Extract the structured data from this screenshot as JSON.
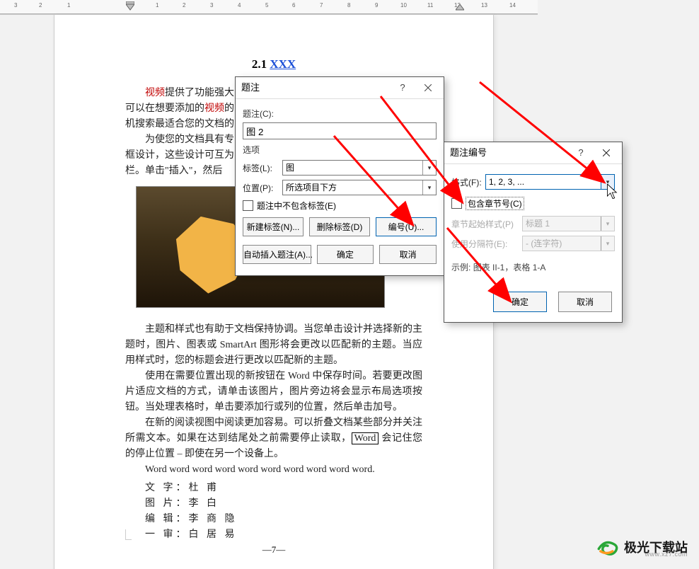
{
  "heading": {
    "num": "2.1",
    "link": "XXX"
  },
  "doc": {
    "para1_a": "视频",
    "para1_b": "提供了功能强大",
    "para1_c": "可以在想要添加的",
    "para1_d": "视频",
    "para1_e": "的",
    "para2": "机搜索最适合您的文档的",
    "para3": "为使您的文档具有专",
    "para4": "框设计，这些设计可互为",
    "para5": "栏。单击\"插入\"，然后",
    "para6": "主题和样式也有助于文档保持协调。当您单击设计并选择新的主题时，图片、图表或 SmartArt 图形将会更改以匹配新的主题。当应用样式时，您的标题会进行更改以匹配新的主题。",
    "para7a": "使用在需要位置出现的新按钮在 Word 中保存时间。若要更改图片适应文档的方式，请单击该图片，图片旁边将会显示布局选项按钮。当处理表格时，单击要添加行或列的位置，然后单击加号。",
    "para8a": "在新的阅读视图中阅读更加容易。可以折叠文档某些部分并关注所需文本。如果在达到结尾处之前需要停止读取，",
    "para8b_box": "Word",
    "para8c": " 会记住您的停止位置 – 即使在另一个设备上。",
    "line_en": "Word word word word word word word word word word.",
    "authors": [
      {
        "label": "文 字：",
        "name": "杜 甫"
      },
      {
        "label": "图 片：",
        "name": "李 白"
      },
      {
        "label": "编 辑：",
        "name": "李 商 隐"
      },
      {
        "label": "一 审：",
        "name": "白 居 易"
      }
    ],
    "page_num": "—7—"
  },
  "dlg1": {
    "title": "题注",
    "lbl_caption": "题注(C):",
    "caption_value": "图 2",
    "lbl_options": "选项",
    "lbl_label": "标签(L):",
    "label_value": "图",
    "lbl_position": "位置(P):",
    "position_value": "所选项目下方",
    "check_exclude": "题注中不包含标签(E)",
    "btn_newlabel": "新建标签(N)...",
    "btn_dellabel": "删除标签(D)",
    "btn_number": "编号(U)...",
    "btn_autoinsert": "自动插入题注(A)...",
    "btn_ok": "确定",
    "btn_cancel": "取消"
  },
  "dlg2": {
    "title": "题注编号",
    "lbl_format": "格式(F):",
    "format_value": "1, 2, 3, ...",
    "check_chapter": "包含章节号(C)",
    "lbl_chapstyle": "章节起始样式(P)",
    "chapstyle_value": "标题 1",
    "lbl_separator": "使用分隔符(E):",
    "separator_value": "- (连字符)",
    "lbl_example": "示例:",
    "example_value": "图表 II-1，表格 1-A",
    "btn_ok": "确定",
    "btn_cancel": "取消"
  },
  "branding": {
    "name": "极光下载站",
    "url": "www.xz7.com"
  }
}
